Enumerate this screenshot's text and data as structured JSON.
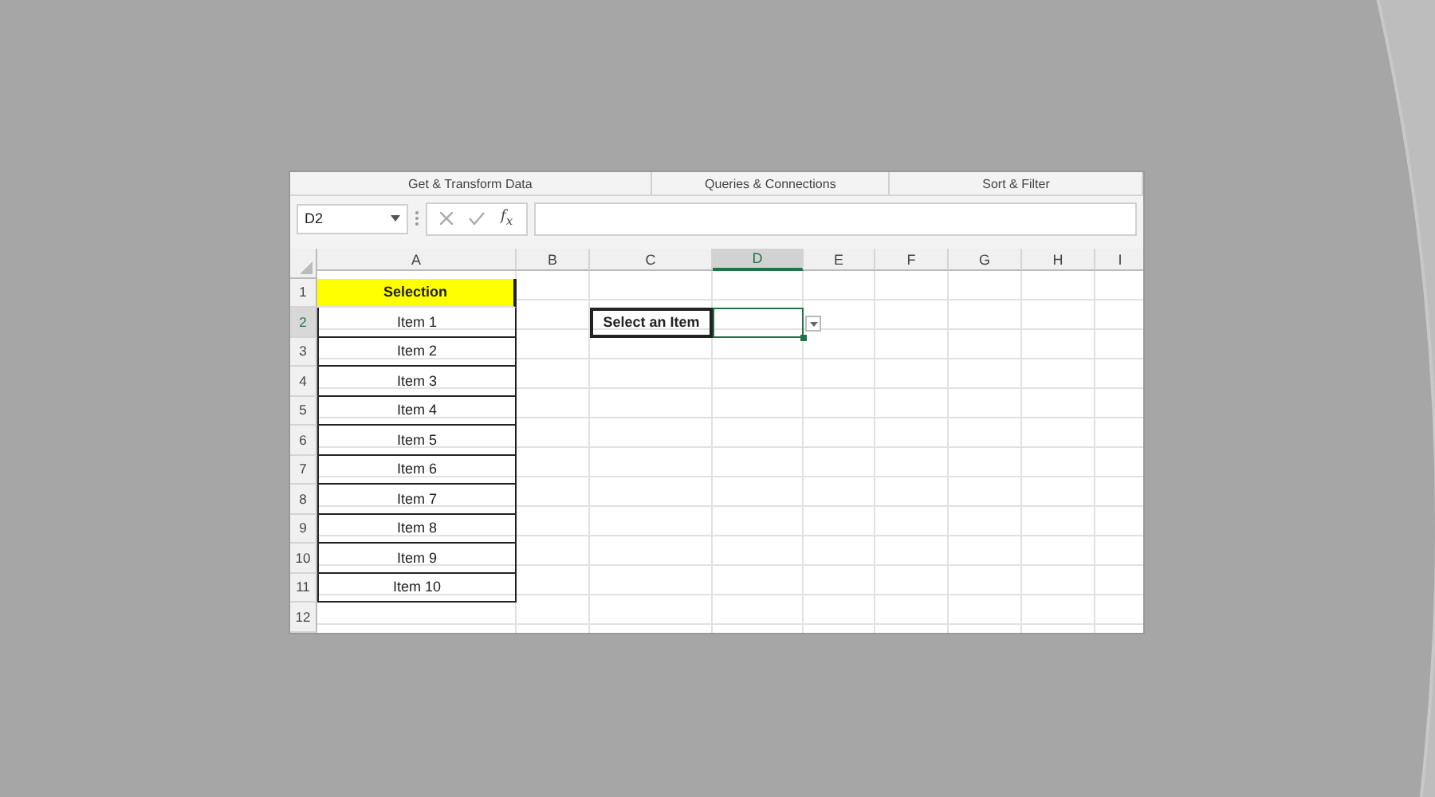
{
  "ribbon_groups": [
    "Get & Transform Data",
    "Queries & Connections",
    "Sort & Filter"
  ],
  "name_box": {
    "value": "D2"
  },
  "formula_bar": {
    "function_label": "f$_{x}$"
  },
  "columns": [
    {
      "label": "A",
      "selected": false
    },
    {
      "label": "B",
      "selected": false
    },
    {
      "label": "C",
      "selected": false
    },
    {
      "label": "D",
      "selected": true
    },
    {
      "label": "E",
      "selected": false
    },
    {
      "label": "F",
      "selected": false
    },
    {
      "label": "G",
      "selected": false
    },
    {
      "label": "H",
      "selected": false
    },
    {
      "label": "I",
      "selected": false
    }
  ],
  "rows": [
    {
      "label": "1",
      "selected": false,
      "col_a": {
        "text": "Selection",
        "kind": "header"
      }
    },
    {
      "label": "2",
      "selected": true,
      "col_a": {
        "text": "Item 1",
        "kind": "item"
      },
      "col_c": {
        "text": "Select an Item",
        "kind": "label"
      },
      "col_d": {
        "active": true,
        "dropdown": true
      }
    },
    {
      "label": "3",
      "selected": false,
      "col_a": {
        "text": "Item 2",
        "kind": "item"
      }
    },
    {
      "label": "4",
      "selected": false,
      "col_a": {
        "text": "Item 3",
        "kind": "item"
      }
    },
    {
      "label": "5",
      "selected": false,
      "col_a": {
        "text": "Item 4",
        "kind": "item"
      }
    },
    {
      "label": "6",
      "selected": false,
      "col_a": {
        "text": "Item 5",
        "kind": "item"
      }
    },
    {
      "label": "7",
      "selected": false,
      "col_a": {
        "text": "Item 6",
        "kind": "item"
      }
    },
    {
      "label": "8",
      "selected": false,
      "col_a": {
        "text": "Item 7",
        "kind": "item"
      }
    },
    {
      "label": "9",
      "selected": false,
      "col_a": {
        "text": "Item 8",
        "kind": "item"
      }
    },
    {
      "label": "10",
      "selected": false,
      "col_a": {
        "text": "Item 9",
        "kind": "item"
      }
    },
    {
      "label": "11",
      "selected": false,
      "col_a": {
        "text": "Item 10",
        "kind": "item"
      }
    },
    {
      "label": "12",
      "selected": false
    }
  ]
}
